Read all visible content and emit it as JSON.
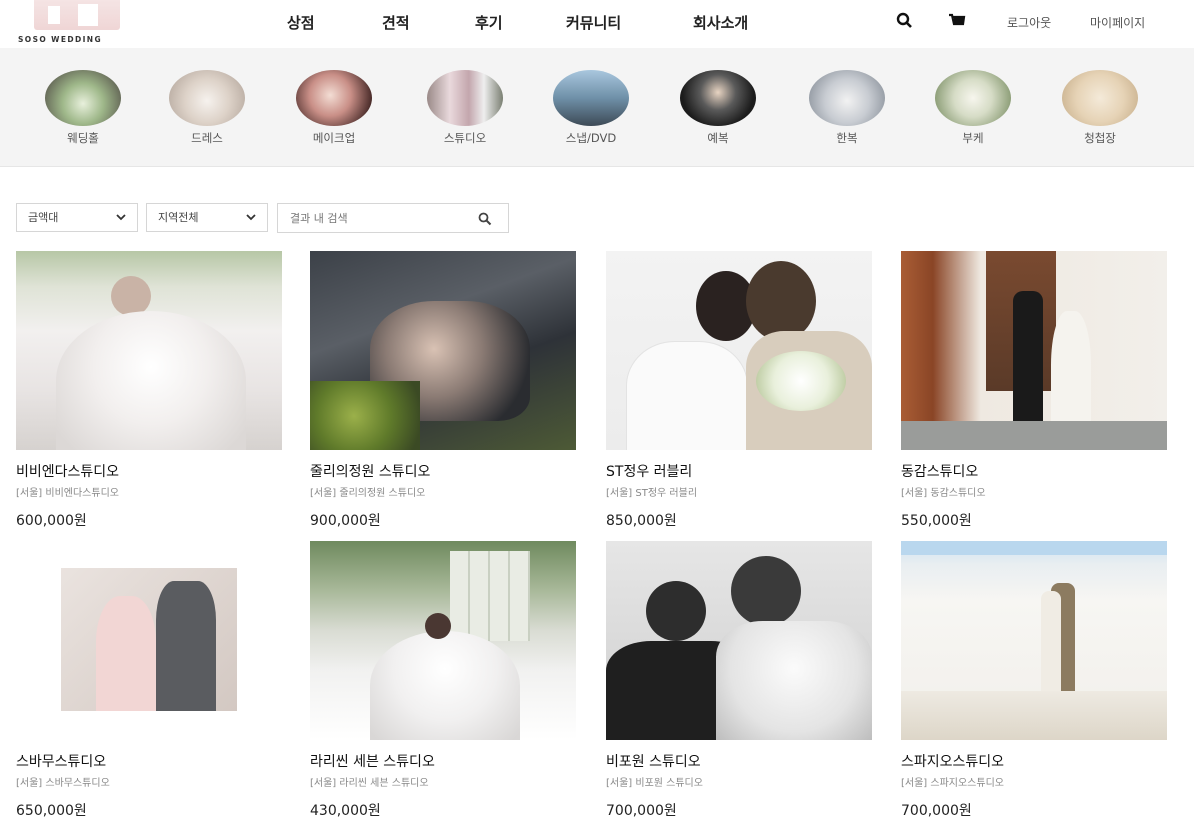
{
  "header": {
    "logo_text": "SOSO WEDDING",
    "nav": [
      "상점",
      "견적",
      "후기",
      "커뮤니티",
      "회사소개"
    ],
    "logout": "로그아웃",
    "mypage": "마이페이지"
  },
  "categories": [
    {
      "label": "웨딩홀"
    },
    {
      "label": "드레스"
    },
    {
      "label": "메이크업"
    },
    {
      "label": "스튜디오"
    },
    {
      "label": "스냅/DVD"
    },
    {
      "label": "예복"
    },
    {
      "label": "한복"
    },
    {
      "label": "부케"
    },
    {
      "label": "청첩장"
    }
  ],
  "filters": {
    "price": "금액대",
    "region": "지역전체",
    "search_placeholder": "결과 내 검색"
  },
  "products": [
    {
      "name": "비비엔다스튜디오",
      "sub": "[서울] 비비엔다스튜디오",
      "price": "600,000원"
    },
    {
      "name": "줄리의정원 스튜디오",
      "sub": "[서울] 줄리의정원 스튜디오",
      "price": "900,000원"
    },
    {
      "name": "ST정우 러블리",
      "sub": "[서울] ST정우 러블리",
      "price": "850,000원"
    },
    {
      "name": "동감스튜디오",
      "sub": "[서울] 동감스튜디오",
      "price": "550,000원"
    },
    {
      "name": "스바무스튜디오",
      "sub": "[서울] 스바무스튜디오",
      "price": "650,000원"
    },
    {
      "name": "라리씬 세븐 스튜디오",
      "sub": "[서울] 라리씬 세븐 스튜디오",
      "price": "430,000원"
    },
    {
      "name": "비포원 스튜디오",
      "sub": "[서울] 비포원 스튜디오",
      "price": "700,000원"
    },
    {
      "name": "스파지오스튜디오",
      "sub": "[서울] 스파지오스튜디오",
      "price": "700,000원"
    }
  ],
  "icons": {
    "search": "search-icon",
    "cart": "cart-icon",
    "chevron": "chevron-down-icon"
  }
}
